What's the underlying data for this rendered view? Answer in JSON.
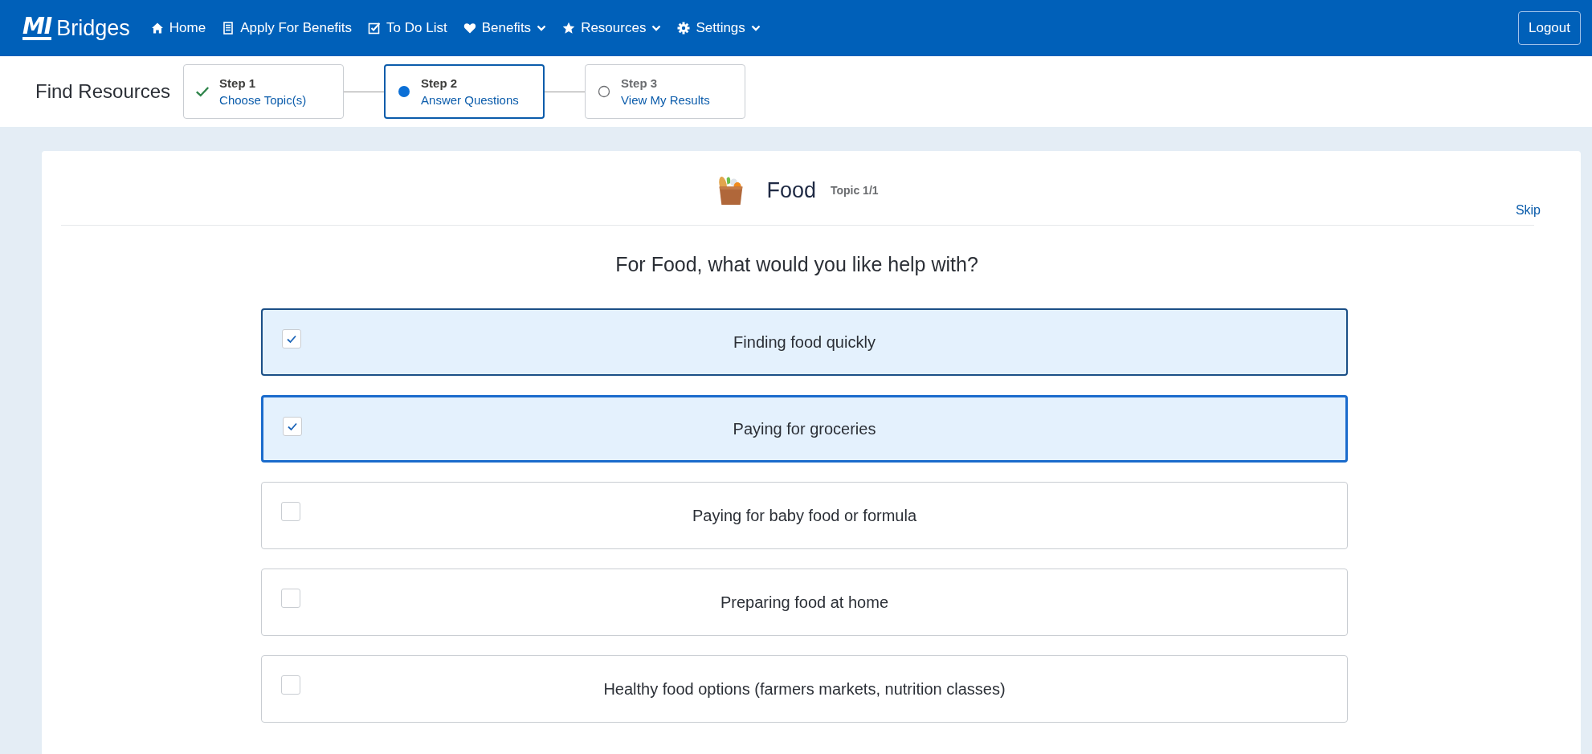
{
  "header": {
    "logo": {
      "mark": "MI",
      "name": "Bridges"
    },
    "nav": [
      {
        "label": "Home",
        "dropdown": false
      },
      {
        "label": "Apply For Benefits",
        "dropdown": false
      },
      {
        "label": "To Do List",
        "dropdown": false
      },
      {
        "label": "Benefits",
        "dropdown": true
      },
      {
        "label": "Resources",
        "dropdown": true
      },
      {
        "label": "Settings",
        "dropdown": true
      }
    ],
    "logout": "Logout"
  },
  "page_title": "Find Resources",
  "steps": [
    {
      "step": "Step 1",
      "label": "Choose Topic(s)",
      "completed": true,
      "selected": false
    },
    {
      "step": "Step 2",
      "label": "Answer Questions",
      "completed": false,
      "selected": true
    },
    {
      "step": "Step 3",
      "label": "View My Results",
      "completed": false,
      "selected": false
    }
  ],
  "topic": {
    "name": "Food",
    "counter": "Topic 1/1",
    "skip": "Skip"
  },
  "question": "For Food, what would you like help with?",
  "options": [
    {
      "label": "Finding food quickly",
      "checked": true,
      "focused": false
    },
    {
      "label": "Paying for groceries",
      "checked": true,
      "focused": true
    },
    {
      "label": "Paying for baby food or formula",
      "checked": false,
      "focused": false
    },
    {
      "label": "Preparing food at home",
      "checked": false,
      "focused": false
    },
    {
      "label": "Healthy food options (farmers markets, nutrition classes)",
      "checked": false,
      "focused": false
    }
  ]
}
